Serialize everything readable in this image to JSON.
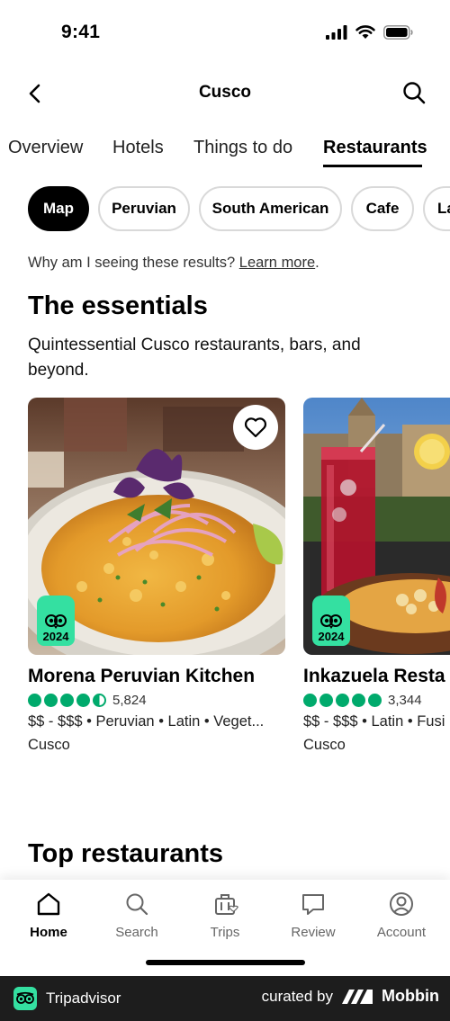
{
  "status": {
    "time": "9:41"
  },
  "header": {
    "title": "Cusco"
  },
  "tabs": [
    {
      "label": "Overview"
    },
    {
      "label": "Hotels"
    },
    {
      "label": "Things to do"
    },
    {
      "label": "Restaurants",
      "active": true
    }
  ],
  "chips": [
    {
      "label": "Map",
      "active": true
    },
    {
      "label": "Peruvian"
    },
    {
      "label": "South American"
    },
    {
      "label": "Cafe"
    },
    {
      "label": "La"
    }
  ],
  "why": {
    "text": "Why am I seeing these results?",
    "link": "Learn more",
    "end": "."
  },
  "essentials": {
    "title": "The essentials",
    "subtitle": "Quintessential Cusco restaurants, bars, and beyond."
  },
  "cards": [
    {
      "name": "Morena Peruvian Kitchen",
      "rating": 4.5,
      "reviews": "5,824",
      "meta": "$$ - $$$ • Peruvian • Latin • Veget...",
      "location": "Cusco",
      "award_year": "2024",
      "saved": false
    },
    {
      "name": "Inkazuela Resta",
      "rating": 5,
      "reviews": "3,344",
      "meta": "$$ - $$$ • Latin • Fusi",
      "location": "Cusco",
      "award_year": "2024"
    }
  ],
  "top_restaurants": {
    "title": "Top restaurants"
  },
  "bottom_nav": [
    {
      "label": "Home",
      "icon": "home-icon",
      "active": true
    },
    {
      "label": "Search",
      "icon": "search-icon"
    },
    {
      "label": "Trips",
      "icon": "suitcase-icon"
    },
    {
      "label": "Review",
      "icon": "review-icon"
    },
    {
      "label": "Account",
      "icon": "account-icon"
    }
  ],
  "branding": {
    "left": "Tripadvisor",
    "curated": "curated by",
    "right": "Mobbin"
  },
  "colors": {
    "accent_green": "#34e0a1",
    "rating_green": "#00aa6c",
    "brand_bar": "#1d1d1d"
  }
}
